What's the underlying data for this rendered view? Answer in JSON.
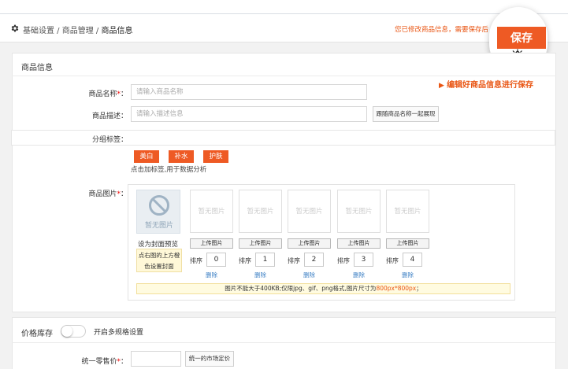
{
  "breadcrumb": {
    "part1": "基础设置",
    "sep1": " / ",
    "part2": "商品管理",
    "sep2": " / ",
    "current": "商品信息"
  },
  "header": {
    "hint": "您已修改商品信息，需要保存后",
    "save_label": "保存",
    "accent": "#ee5a24"
  },
  "callout": "编辑好商品信息进行保存",
  "section_goods": {
    "title": "商品信息"
  },
  "fields": {
    "name_label": "商品名称",
    "name_placeholder": "请输入商品名称",
    "desc_label": "商品描述：",
    "desc_placeholder": "请输入描述信息",
    "follow_button": "跟随商品名称一起展现",
    "tags_label": "分组标签：",
    "images_label": "商品图片"
  },
  "required_mark": "*",
  "colon": "：",
  "tags": [
    "美白",
    "补水",
    "护肤"
  ],
  "tag_hint": "点击加标签,用于数据分析",
  "images": {
    "no_image": "暂无图片",
    "upload_label": "上传图片",
    "set_cover": "设为封面预览",
    "cover_tip_line1": "点右图的上方橙",
    "cover_tip_line2": "色设置封面",
    "sort_label": "排序",
    "delete_label": "删除",
    "sort_values": [
      "0",
      "1",
      "2",
      "3",
      "4"
    ],
    "notice_prefix": "图片不能大于400KB;仅限jpg、gif、png格式,图片尺寸为",
    "notice_size": "800px*800px",
    "notice_suffix": "；"
  },
  "section_price": {
    "title": "价格库存",
    "toggle_label": "开启多规格设置",
    "toggle_on": false
  },
  "price": {
    "label": "统一零售价",
    "market_button": "统一的市场定价"
  }
}
